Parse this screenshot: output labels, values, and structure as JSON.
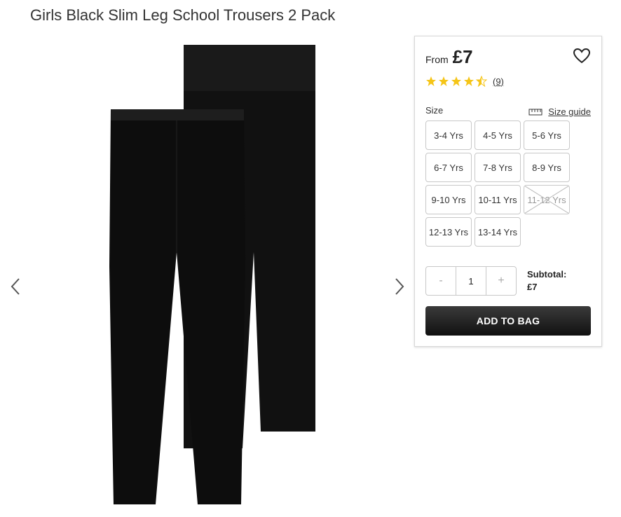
{
  "product": {
    "title": "Girls Black Slim Leg School Trousers 2 Pack"
  },
  "gallery": {
    "prev_icon": "chevron-left-icon",
    "next_icon": "chevron-right-icon"
  },
  "pricing": {
    "prefix": "From",
    "price": "£7"
  },
  "wishlist": {
    "icon": "heart-icon"
  },
  "rating": {
    "stars": 4.5,
    "max": 5,
    "count": "(9)",
    "star_color": "#f5c518"
  },
  "size": {
    "label": "Size",
    "guide_label": "Size guide",
    "guide_icon": "ruler-icon",
    "options": [
      {
        "label": "3-4 Yrs",
        "available": true
      },
      {
        "label": "4-5 Yrs",
        "available": true
      },
      {
        "label": "5-6 Yrs",
        "available": true
      },
      {
        "label": "6-7 Yrs",
        "available": true
      },
      {
        "label": "7-8 Yrs",
        "available": true
      },
      {
        "label": "8-9 Yrs",
        "available": true
      },
      {
        "label": "9-10 Yrs",
        "available": true
      },
      {
        "label": "10-11 Yrs",
        "available": true
      },
      {
        "label": "11-12 Yrs",
        "available": false
      },
      {
        "label": "12-13 Yrs",
        "available": true
      },
      {
        "label": "13-14 Yrs",
        "available": true
      }
    ]
  },
  "quantity": {
    "decrement": "-",
    "value": "1",
    "increment": "+"
  },
  "subtotal": {
    "label": "Subtotal:",
    "value": "£7"
  },
  "cart": {
    "add_label": "ADD TO BAG"
  },
  "colors": {
    "button_dark": "#1a1a1a",
    "border": "#c8c8c8"
  }
}
